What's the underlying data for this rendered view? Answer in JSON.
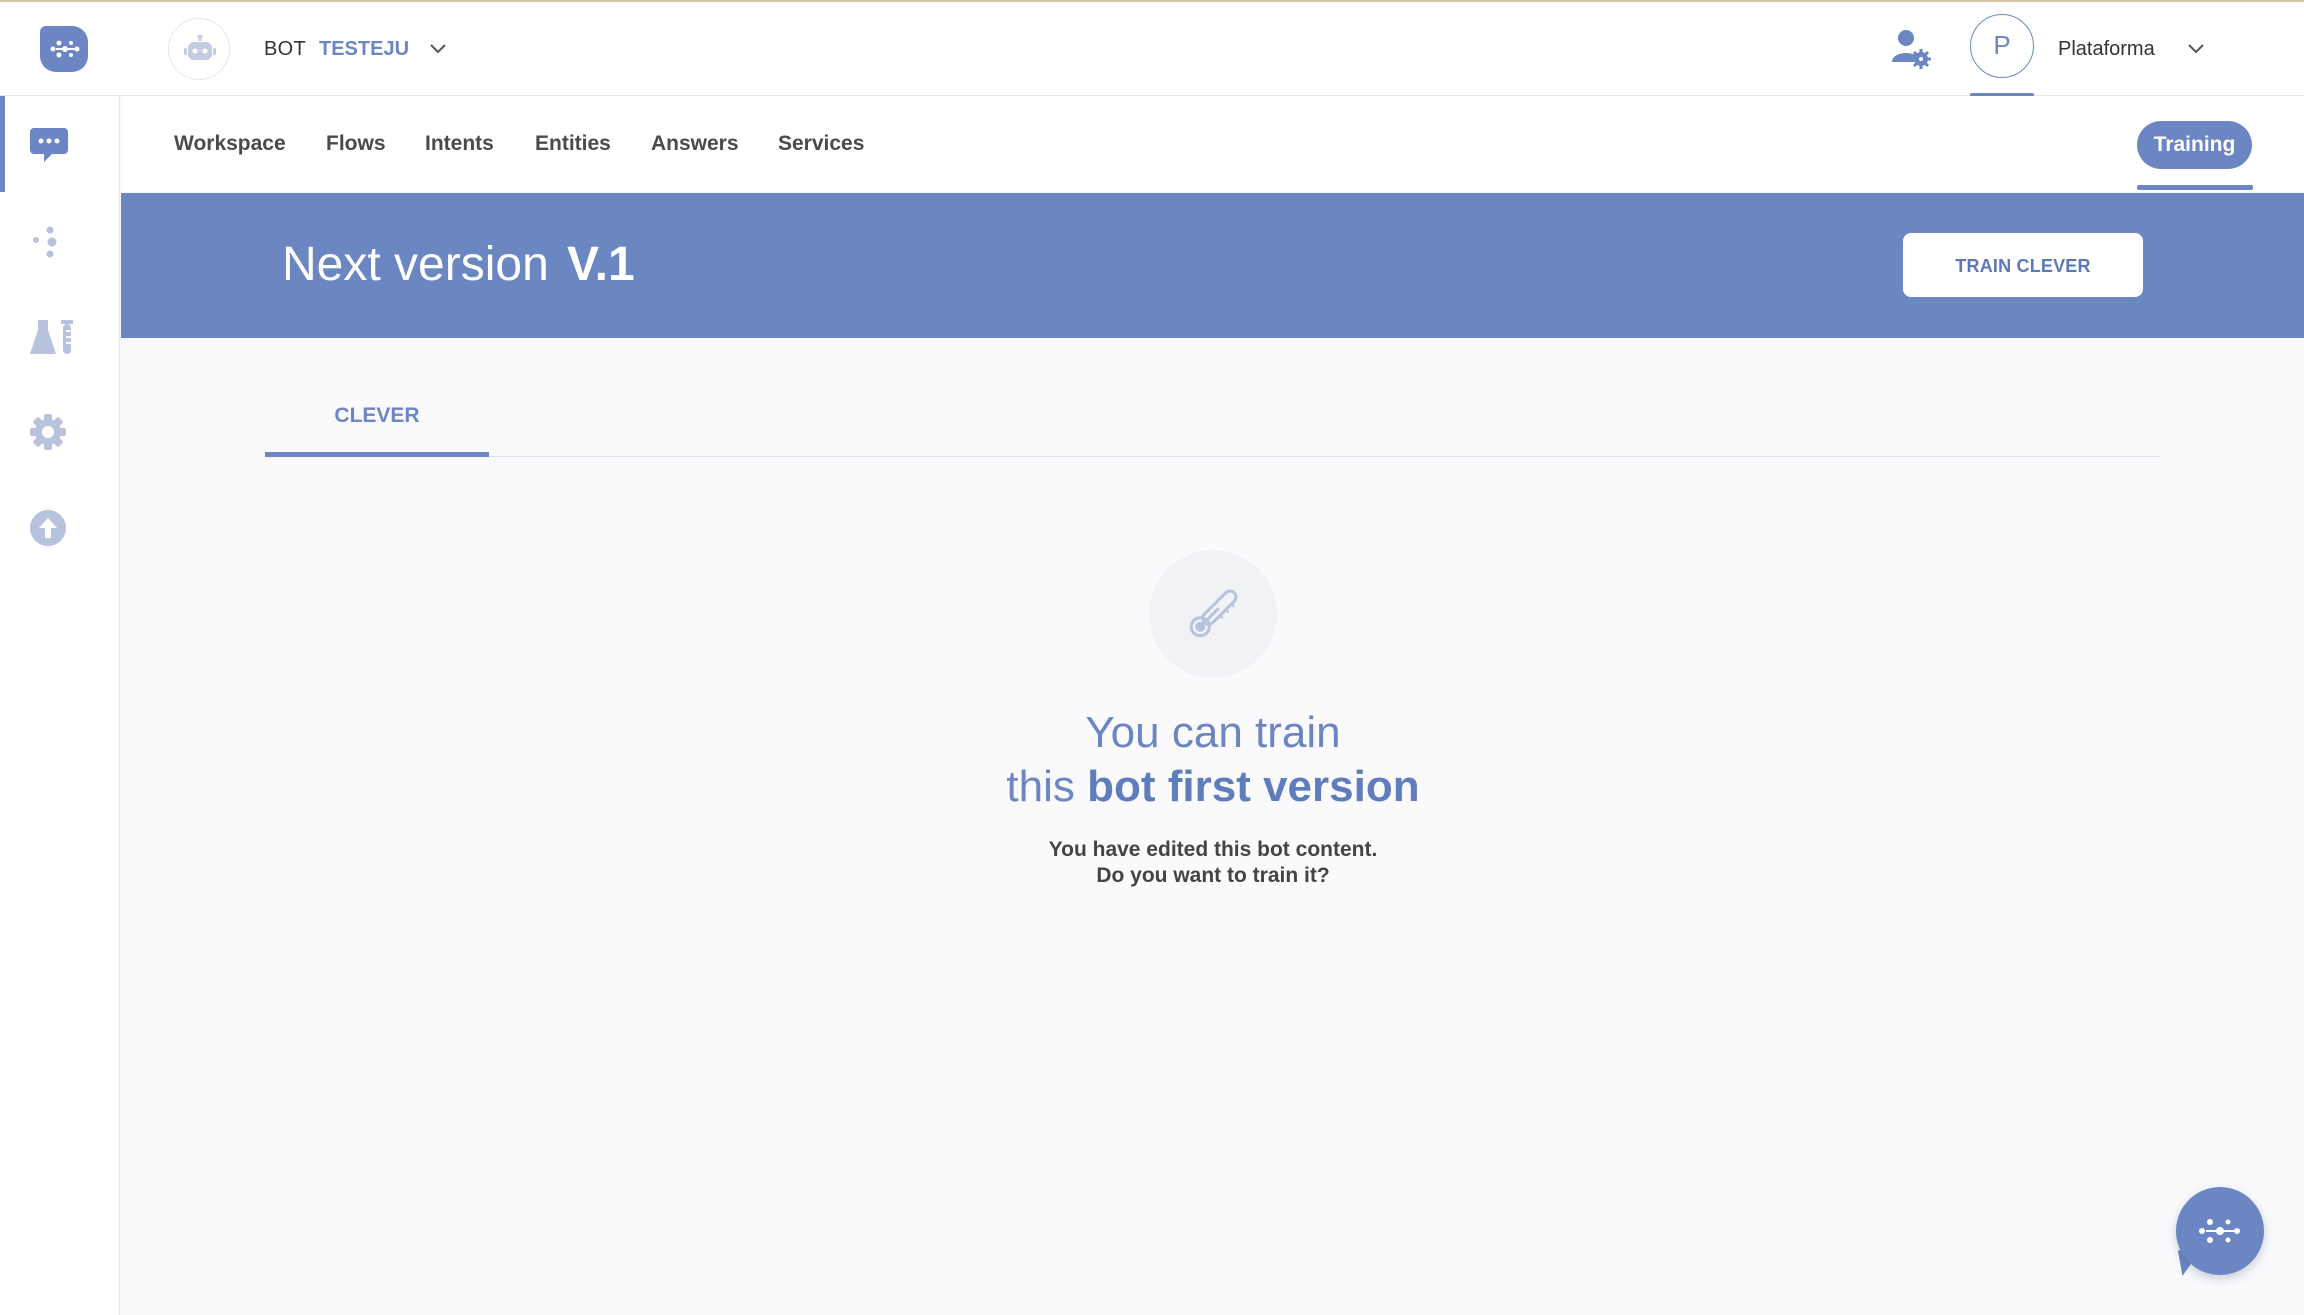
{
  "header": {
    "bot_prefix": "BOT",
    "bot_name": "TESTEJU",
    "user_initial": "P",
    "user_name": "Plataforma"
  },
  "nav": {
    "items": [
      "Workspace",
      "Flows",
      "Intents",
      "Entities",
      "Answers",
      "Services"
    ],
    "active_pill": "Training"
  },
  "banner": {
    "label": "Next version",
    "version": "V.1",
    "train_button": "TRAIN CLEVER"
  },
  "tabs": {
    "active": "CLEVER"
  },
  "empty_state": {
    "headline_line1": "You can train",
    "headline_line2_plain": "this ",
    "headline_line2_strong": "bot first version",
    "sub_line1": "You have edited this bot content.",
    "sub_line2": "Do you want to train it?"
  },
  "sidebar": {
    "items": [
      "chat-icon",
      "flows-icon",
      "flask-icon",
      "gear-icon",
      "upload-icon"
    ]
  },
  "colors": {
    "accent": "#6b86c2",
    "banner": "#6a87c1",
    "icon_muted": "#b7c2dd"
  }
}
